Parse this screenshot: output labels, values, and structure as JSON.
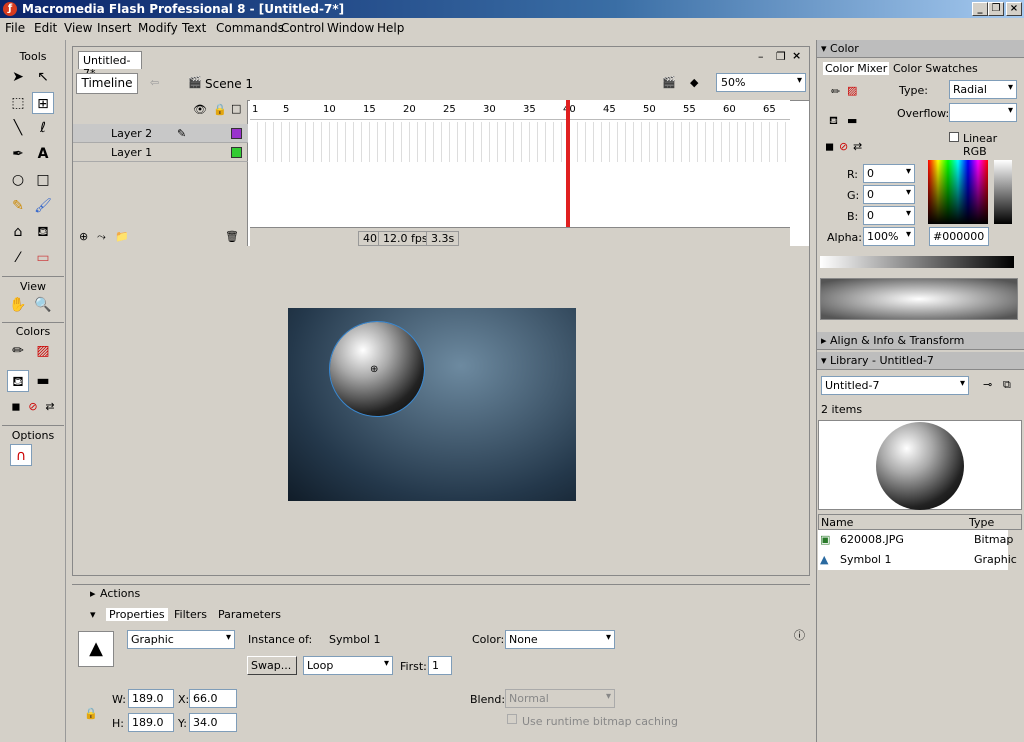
{
  "window": {
    "title": "Macromedia Flash Professional 8 - [Untitled-7*]"
  },
  "menu": [
    "File",
    "Edit",
    "View",
    "Insert",
    "Modify",
    "Text",
    "Commands",
    "Control",
    "Window",
    "Help"
  ],
  "tools": {
    "header": "Tools",
    "view": "View",
    "colors": "Colors",
    "options": "Options"
  },
  "doc": {
    "tab": "Untitled-7*",
    "timeline_btn": "Timeline",
    "scene": "Scene 1",
    "zoom": "50%"
  },
  "layers": [
    {
      "name": "Layer 2",
      "color": "#9933cc"
    },
    {
      "name": "Layer 1",
      "color": "#33cc33"
    }
  ],
  "ruler": [
    "1",
    "5",
    "10",
    "15",
    "20",
    "25",
    "30",
    "35",
    "40",
    "45",
    "50",
    "55",
    "60",
    "65"
  ],
  "status": {
    "frame": "40",
    "fps": "12.0 fps",
    "time": "3.3s"
  },
  "actions": {
    "title": "Actions"
  },
  "props": {
    "tabs": [
      "Properties",
      "Filters",
      "Parameters"
    ],
    "type": "Graphic",
    "instance_label": "Instance of:",
    "instance": "Symbol 1",
    "swap": "Swap...",
    "loop": "Loop",
    "first_label": "First:",
    "first": "1",
    "color_label": "Color:",
    "color": "None",
    "w_label": "W:",
    "w": "189.0",
    "x_label": "X:",
    "x": "66.0",
    "h_label": "H:",
    "h": "189.0",
    "y_label": "Y:",
    "y": "34.0",
    "blend_label": "Blend:",
    "blend": "Normal",
    "cache": "Use runtime bitmap caching"
  },
  "color": {
    "title": "Color",
    "tab1": "Color Mixer",
    "tab2": "Color Swatches",
    "type_label": "Type:",
    "type": "Radial",
    "overflow_label": "Overflow:",
    "linear": "Linear RGB",
    "r_label": "R:",
    "r": "0",
    "g_label": "G:",
    "g": "0",
    "b_label": "B:",
    "b": "0",
    "alpha_label": "Alpha:",
    "alpha": "100%",
    "hex": "#000000"
  },
  "align": {
    "title": "Align & Info & Transform"
  },
  "library": {
    "title": "Library - Untitled-7",
    "doc": "Untitled-7",
    "count": "2 items",
    "col_name": "Name",
    "col_type": "Type",
    "items": [
      {
        "name": "620008.JPG",
        "type": "Bitmap"
      },
      {
        "name": "Symbol 1",
        "type": "Graphic"
      }
    ]
  }
}
